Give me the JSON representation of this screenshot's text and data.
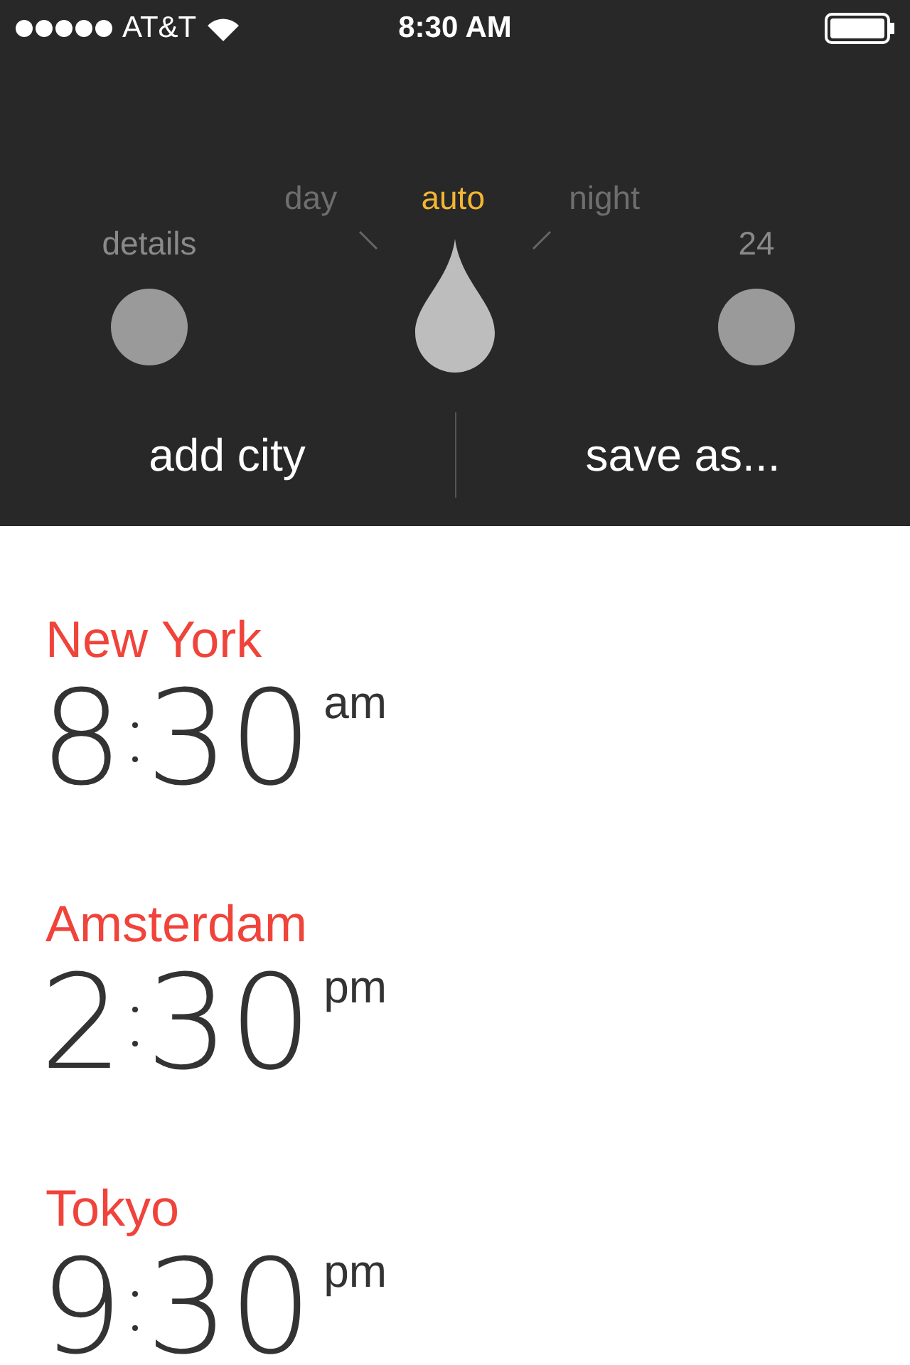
{
  "status_bar": {
    "carrier": "AT&T",
    "time": "8:30 AM"
  },
  "controls": {
    "toggles": [
      {
        "label": "details"
      },
      {
        "label": "24"
      }
    ],
    "modes": [
      {
        "label": "day",
        "selected": false
      },
      {
        "label": "auto",
        "selected": true
      },
      {
        "label": "night",
        "selected": false
      }
    ],
    "actions": [
      "add city",
      "save as..."
    ]
  },
  "cities": [
    {
      "name": "New York",
      "hour": "8",
      "minute": "30",
      "period": "am"
    },
    {
      "name": "Amsterdam",
      "hour": "2",
      "minute": "30",
      "period": "pm"
    },
    {
      "name": "Tokyo",
      "hour": "9",
      "minute": "30",
      "period": "pm"
    }
  ]
}
